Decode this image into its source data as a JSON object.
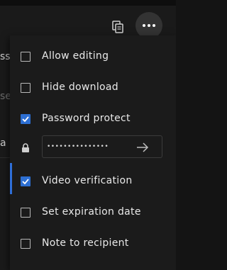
{
  "background": {
    "partial_text_1": "ss",
    "partial_text_2": "se",
    "partial_text_3": "a"
  },
  "toolbar": {
    "copy_icon": "copy-icon",
    "more_icon": "more-options-icon"
  },
  "menu": {
    "items": [
      {
        "label": "Allow editing",
        "checked": false
      },
      {
        "label": "Hide download",
        "checked": false
      },
      {
        "label": "Password protect",
        "checked": true
      },
      {
        "label": "Video verification",
        "checked": true,
        "active": true
      },
      {
        "label": "Set expiration date",
        "checked": false
      },
      {
        "label": "Note to recipient",
        "checked": false
      }
    ],
    "password": {
      "value": "•••••••••••••••",
      "lock_icon": "lock-icon",
      "submit_icon": "arrow-right-icon"
    }
  },
  "colors": {
    "accent": "#2d6fd2",
    "menu_bg": "#1b1b1b",
    "text": "#e9e9e9"
  }
}
